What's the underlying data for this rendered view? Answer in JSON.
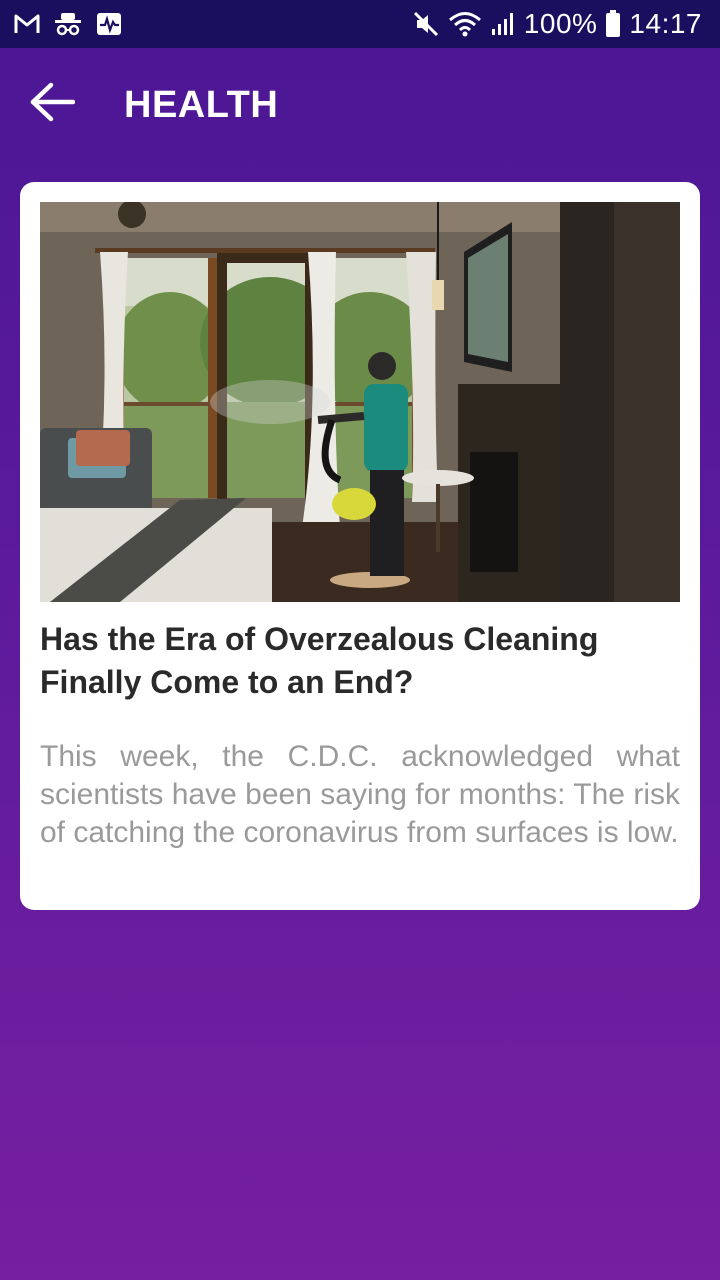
{
  "status_bar": {
    "left_icons": [
      "gmail-icon",
      "incognito-icon",
      "activity-icon"
    ],
    "right_icons": [
      "mute-icon",
      "wifi-icon",
      "signal-icon",
      "battery-icon"
    ],
    "battery": "100%",
    "time": "14:17"
  },
  "app_bar": {
    "back_icon": "arrow-left-icon",
    "title": "HEALTH"
  },
  "article": {
    "image_description": "hotel-room-disinfection-photo",
    "title": "Has the Era of Overzealous Cleaning Finally Come to an End?",
    "summary": "This week, the C.D.C. acknowledged what scientists have been saying for months: The risk of catching the coronavirus from surfaces is low."
  },
  "colors": {
    "status_bar_bg": "#1a0f5e",
    "background_top": "#4a1694",
    "background_bottom": "#761fa0",
    "card_bg": "#ffffff",
    "title_text": "#2a2a2a",
    "summary_text": "#9a9a9a"
  }
}
